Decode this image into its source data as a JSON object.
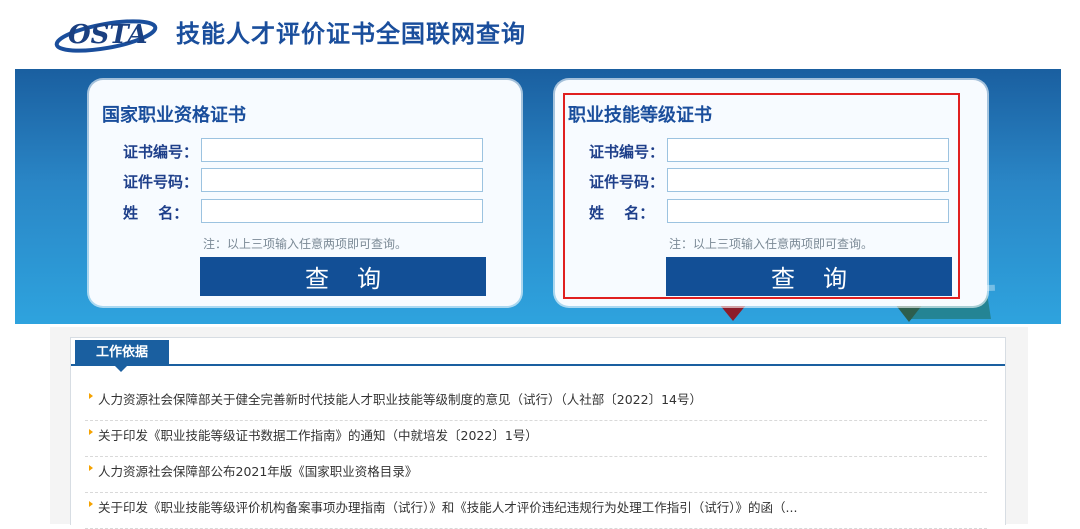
{
  "header": {
    "logo_text": "OSTA",
    "title": "技能人才评价证书全国联网查询"
  },
  "panels": [
    {
      "title": "国家职业资格证书",
      "fields": [
        {
          "label": "证书编号：",
          "value": "",
          "placeholder": ""
        },
        {
          "label": "证件号码：",
          "value": "",
          "placeholder": ""
        },
        {
          "label": "姓　 名：",
          "value": "",
          "placeholder": ""
        }
      ],
      "note": "注：以上三项输入任意两项即可查询。",
      "button": "查询"
    },
    {
      "title": "职业技能等级证书",
      "fields": [
        {
          "label": "证书编号：",
          "value": "",
          "placeholder": ""
        },
        {
          "label": "证件号码：",
          "value": "",
          "placeholder": ""
        },
        {
          "label": "姓　 名：",
          "value": "",
          "placeholder": ""
        }
      ],
      "note": "注：以上三项输入任意两项即可查询。",
      "button": "查询"
    }
  ],
  "basis": {
    "tab_label": "工作依据",
    "items": [
      "人力资源社会保障部关于健全完善新时代技能人才职业技能等级制度的意见（试行）（人社部〔2022〕14号）",
      "关于印发《职业技能等级证书数据工作指南》的通知（中就培发〔2022〕1号）",
      "人力资源社会保障部公布2021年版《国家职业资格目录》",
      "关于印发《职业技能等级评价机构备案事项办理指南（试行）》和《技能人才评价违纪违规行为处理工作指引（试行）》的函（..."
    ]
  },
  "colors": {
    "brand_blue": "#1a4e9c",
    "button_blue": "#124f96",
    "highlight_red": "#e02020",
    "bullet_orange": "#f5a200"
  }
}
